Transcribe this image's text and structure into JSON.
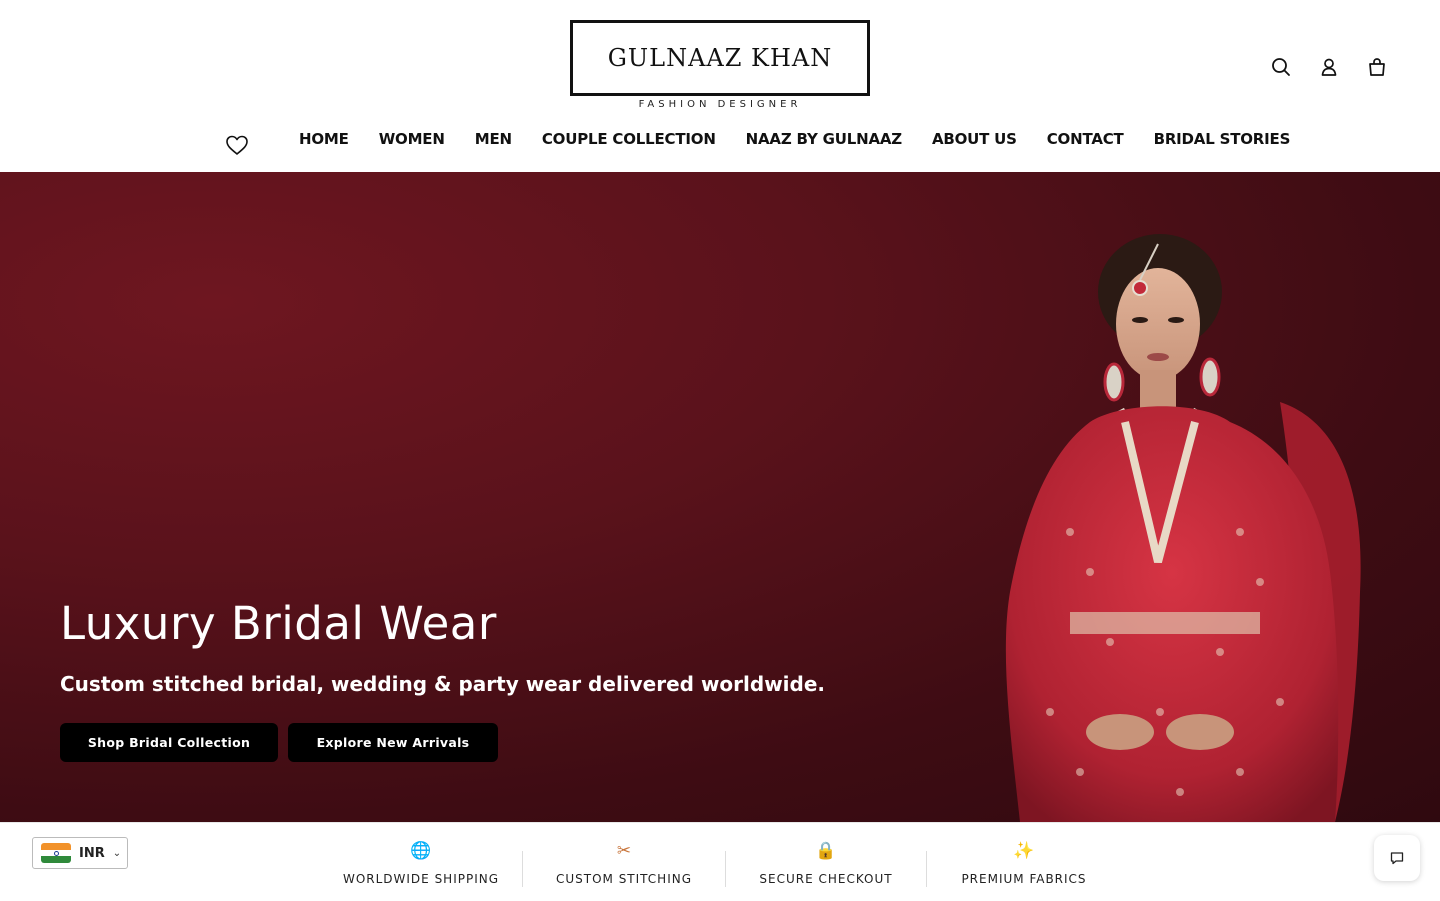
{
  "header": {
    "logo_title": "GULNAAZ KHAN",
    "logo_subtitle": "FASHION DESIGNER",
    "icons": [
      "search-icon",
      "account-icon",
      "cart-icon",
      "heart-icon"
    ]
  },
  "nav": {
    "items": [
      {
        "label": "HOME"
      },
      {
        "label": "WOMEN"
      },
      {
        "label": "MEN"
      },
      {
        "label": "COUPLE COLLECTION"
      },
      {
        "label": "NAAZ BY GULNAAZ"
      },
      {
        "label": "ABOUT US"
      },
      {
        "label": "CONTACT"
      },
      {
        "label": "BRIDAL STORIES"
      }
    ]
  },
  "hero": {
    "title": "Luxury Bridal Wear",
    "subtitle": "Custom stitched bridal, wedding & party wear delivered worldwide.",
    "primary_button": "Shop Bridal Collection",
    "secondary_button": "Explore New Arrivals",
    "background_color": "#5a121b",
    "dress_color": "#c8283a"
  },
  "currency": {
    "code": "INR",
    "flag": "india-flag-icon"
  },
  "features": [
    {
      "icon": "globe-icon",
      "glyph": "🌐",
      "label": "WORLDWIDE SHIPPING"
    },
    {
      "icon": "scissors-icon",
      "glyph": "✂",
      "label": "CUSTOM STITCHING"
    },
    {
      "icon": "lock-icon",
      "glyph": "🔒",
      "label": "SECURE CHECKOUT"
    },
    {
      "icon": "sparkles-icon",
      "glyph": "✨",
      "label": "PREMIUM FABRICS"
    }
  ],
  "chat": {
    "icon": "chat-icon"
  }
}
